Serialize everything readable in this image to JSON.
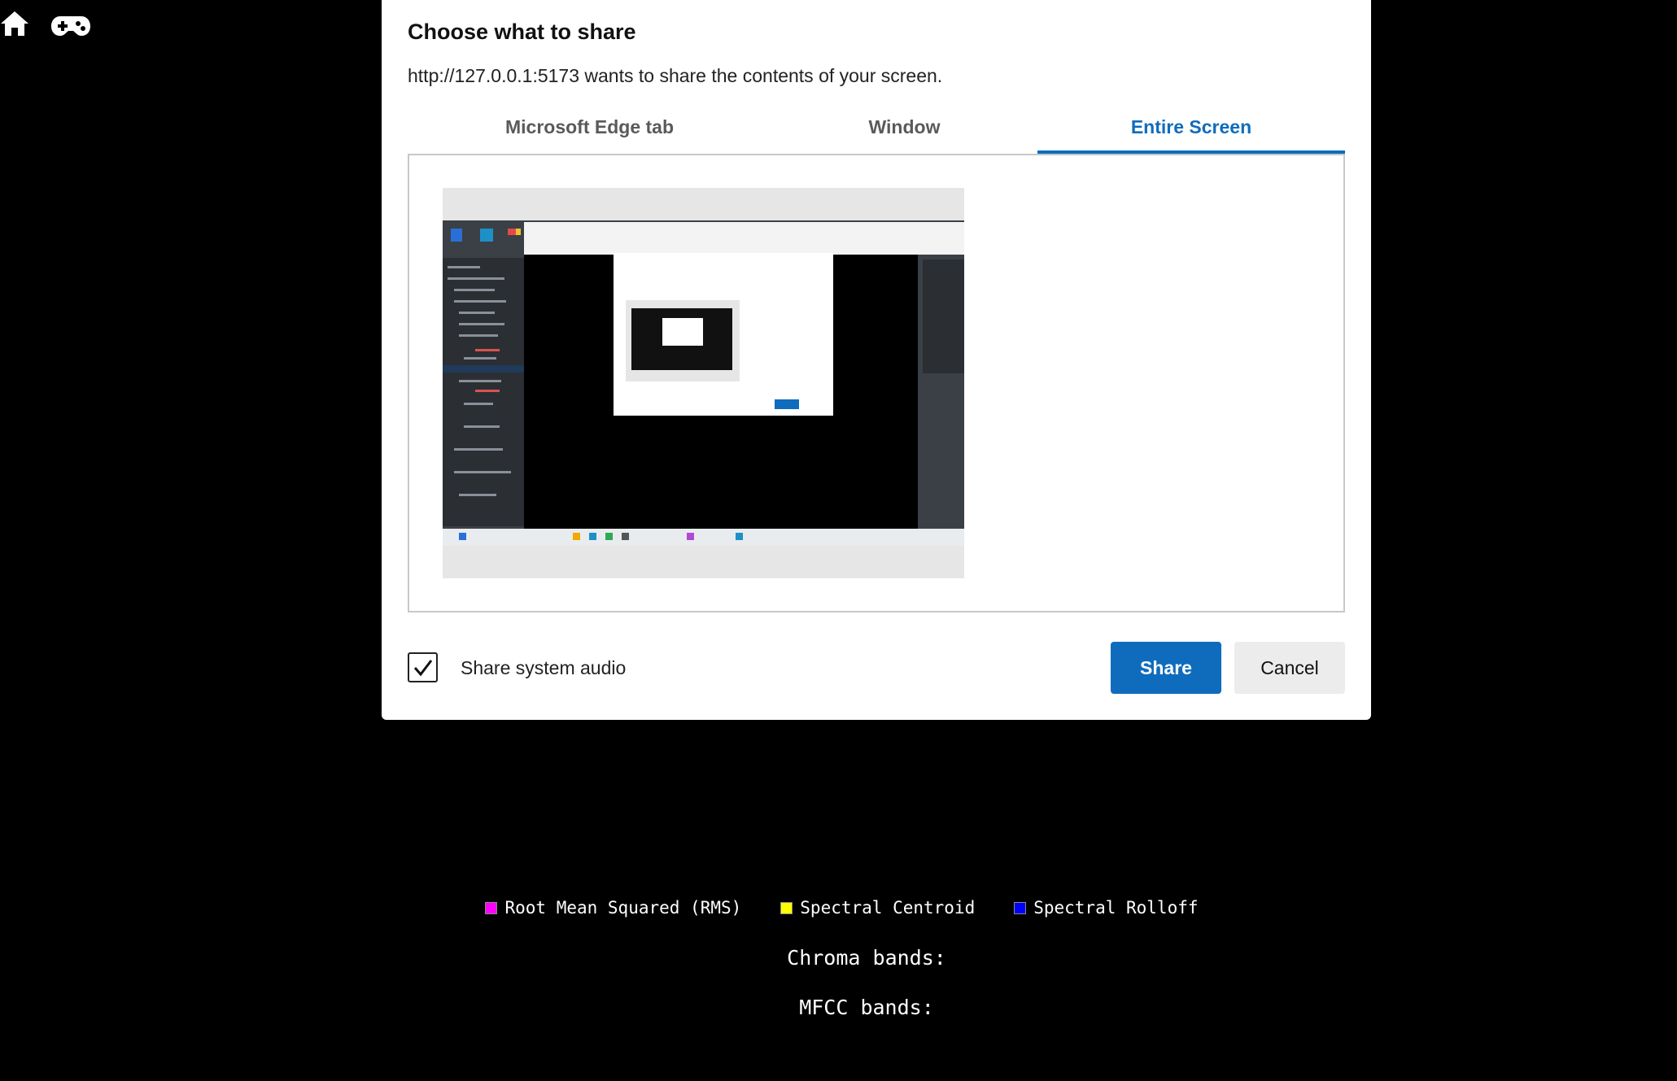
{
  "dialog": {
    "title": "Choose what to share",
    "message": "http://127.0.0.1:5173 wants to share the contents of your screen.",
    "tabs": [
      {
        "label": "Microsoft Edge tab",
        "selected": false
      },
      {
        "label": "Window",
        "selected": false
      },
      {
        "label": "Entire Screen",
        "selected": true
      }
    ],
    "audio_checkbox": {
      "label": "Share system audio",
      "checked": true
    },
    "share_label": "Share",
    "cancel_label": "Cancel",
    "accent_color": "#0f6cbd"
  },
  "icons": {
    "home": "home-icon",
    "gamepad": "gamepad-icon"
  },
  "legend": [
    {
      "label": "Root Mean Squared (RMS)",
      "color": "#ff00ff"
    },
    {
      "label": "Spectral Centroid",
      "color": "#ffff00"
    },
    {
      "label": "Spectral Rolloff",
      "color": "#0000ff"
    }
  ],
  "chroma_label": "Chroma bands:",
  "mfcc_label": "MFCC bands:"
}
